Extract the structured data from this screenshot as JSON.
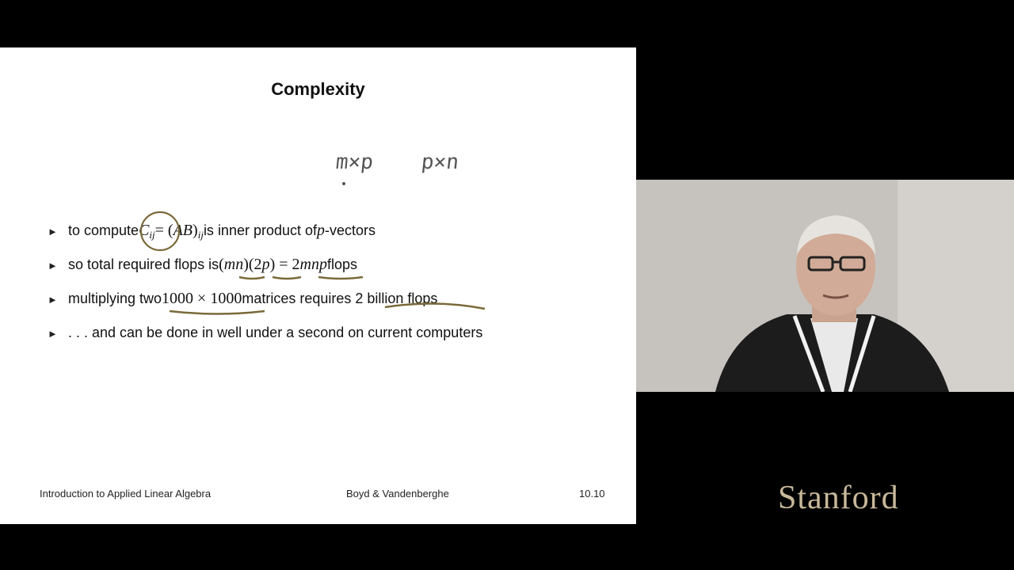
{
  "slide": {
    "title": "Complexity",
    "handwriting": {
      "dims_left": "m×p",
      "dims_right": "p×n"
    },
    "bullets": {
      "b1": {
        "text_a": "to compute ",
        "c": "C",
        "c_sub": "ij",
        "eq": " = (",
        "ab": "AB",
        "close": ")",
        "ab_sub": "ij",
        "text_b": " is inner product of ",
        "p": "p",
        "text_c": "-vectors"
      },
      "b2": {
        "text_a": "so total required flops is ",
        "math_a": "(",
        "mn": "mn",
        "math_b": ")(2",
        "p": "p",
        "math_c": ") = 2",
        "mnp": "mnp",
        "text_b": " flops"
      },
      "b3": {
        "text_a": "multiplying two ",
        "math": "1000 × 1000",
        "text_b": " matrices requires 2 billion flops"
      },
      "b4": {
        "text": ". . . and can be done in well under a second on current computers"
      }
    },
    "footer": {
      "left": "Introduction to Applied Linear Algebra",
      "center": "Boyd & Vandenberghe",
      "right": "10.10"
    }
  },
  "brand": "Stanford",
  "colors": {
    "background": "#000000",
    "slide": "#ffffff",
    "ink": "#7a6a3a",
    "brand": "#c8b89a"
  }
}
